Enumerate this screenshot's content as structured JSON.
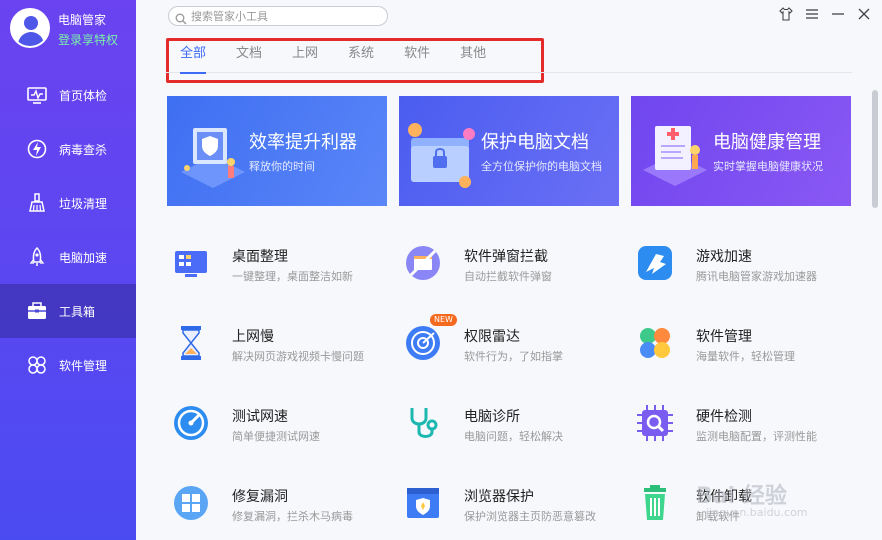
{
  "sidebar": {
    "user_name": "电脑管家",
    "vip_link": "登录享特权",
    "items": [
      {
        "label": "首页体检",
        "icon": "monitor-icon"
      },
      {
        "label": "病毒查杀",
        "icon": "lightning-shield-icon"
      },
      {
        "label": "垃圾清理",
        "icon": "broom-icon"
      },
      {
        "label": "电脑加速",
        "icon": "rocket-icon"
      },
      {
        "label": "工具箱",
        "icon": "toolbox-icon",
        "active": true
      },
      {
        "label": "软件管理",
        "icon": "app-manager-icon"
      }
    ]
  },
  "search": {
    "placeholder": "搜索管家小工具"
  },
  "tabs": [
    "全部",
    "文档",
    "上网",
    "系统",
    "软件",
    "其他"
  ],
  "banners": [
    {
      "title": "效率提升利器",
      "subtitle": "释放你的时间"
    },
    {
      "title": "保护电脑文档",
      "subtitle": "全方位保护你的电脑文档"
    },
    {
      "title": "电脑健康管理",
      "subtitle": "实时掌握电脑健康状况"
    }
  ],
  "tools": [
    {
      "name": "桌面整理",
      "desc": "一键整理，桌面整洁如新",
      "icon": "desktop-organize-icon"
    },
    {
      "name": "软件弹窗拦截",
      "desc": "自动拦截软件弹窗",
      "icon": "popup-block-icon"
    },
    {
      "name": "游戏加速",
      "desc": "腾讯电脑管家游戏加速器",
      "icon": "game-accelerate-icon"
    },
    {
      "name": "上网慢",
      "desc": "解决网页游戏视频卡慢问题",
      "icon": "hourglass-icon"
    },
    {
      "name": "权限雷达",
      "desc": "软件行为，了如指掌",
      "icon": "radar-icon",
      "badge": "NEW"
    },
    {
      "name": "软件管理",
      "desc": "海量软件，轻松管理",
      "icon": "clover-icon"
    },
    {
      "name": "测试网速",
      "desc": "简单便捷测试网速",
      "icon": "speedometer-icon"
    },
    {
      "name": "电脑诊所",
      "desc": "电脑问题，轻松解决",
      "icon": "stethoscope-icon"
    },
    {
      "name": "硬件检测",
      "desc": "监测电脑配置，评测性能",
      "icon": "chip-search-icon"
    },
    {
      "name": "修复漏洞",
      "desc": "修复漏洞，拦杀木马病毒",
      "icon": "windows-patch-icon"
    },
    {
      "name": "浏览器保护",
      "desc": "保护浏览器主页防恶意篡改",
      "icon": "browser-shield-icon"
    },
    {
      "name": "软件卸载",
      "desc": "卸载软件",
      "icon": "trash-icon"
    }
  ],
  "watermark": {
    "text": "Bai 经验",
    "url": "jingyan.baidu.com"
  },
  "colors": {
    "sidebar_top": "#6b43f0",
    "sidebar_bottom": "#4b4bf2",
    "accent": "#3d6bf5",
    "highlight_frame": "#e52a2a",
    "vip": "#7cf1a8"
  }
}
